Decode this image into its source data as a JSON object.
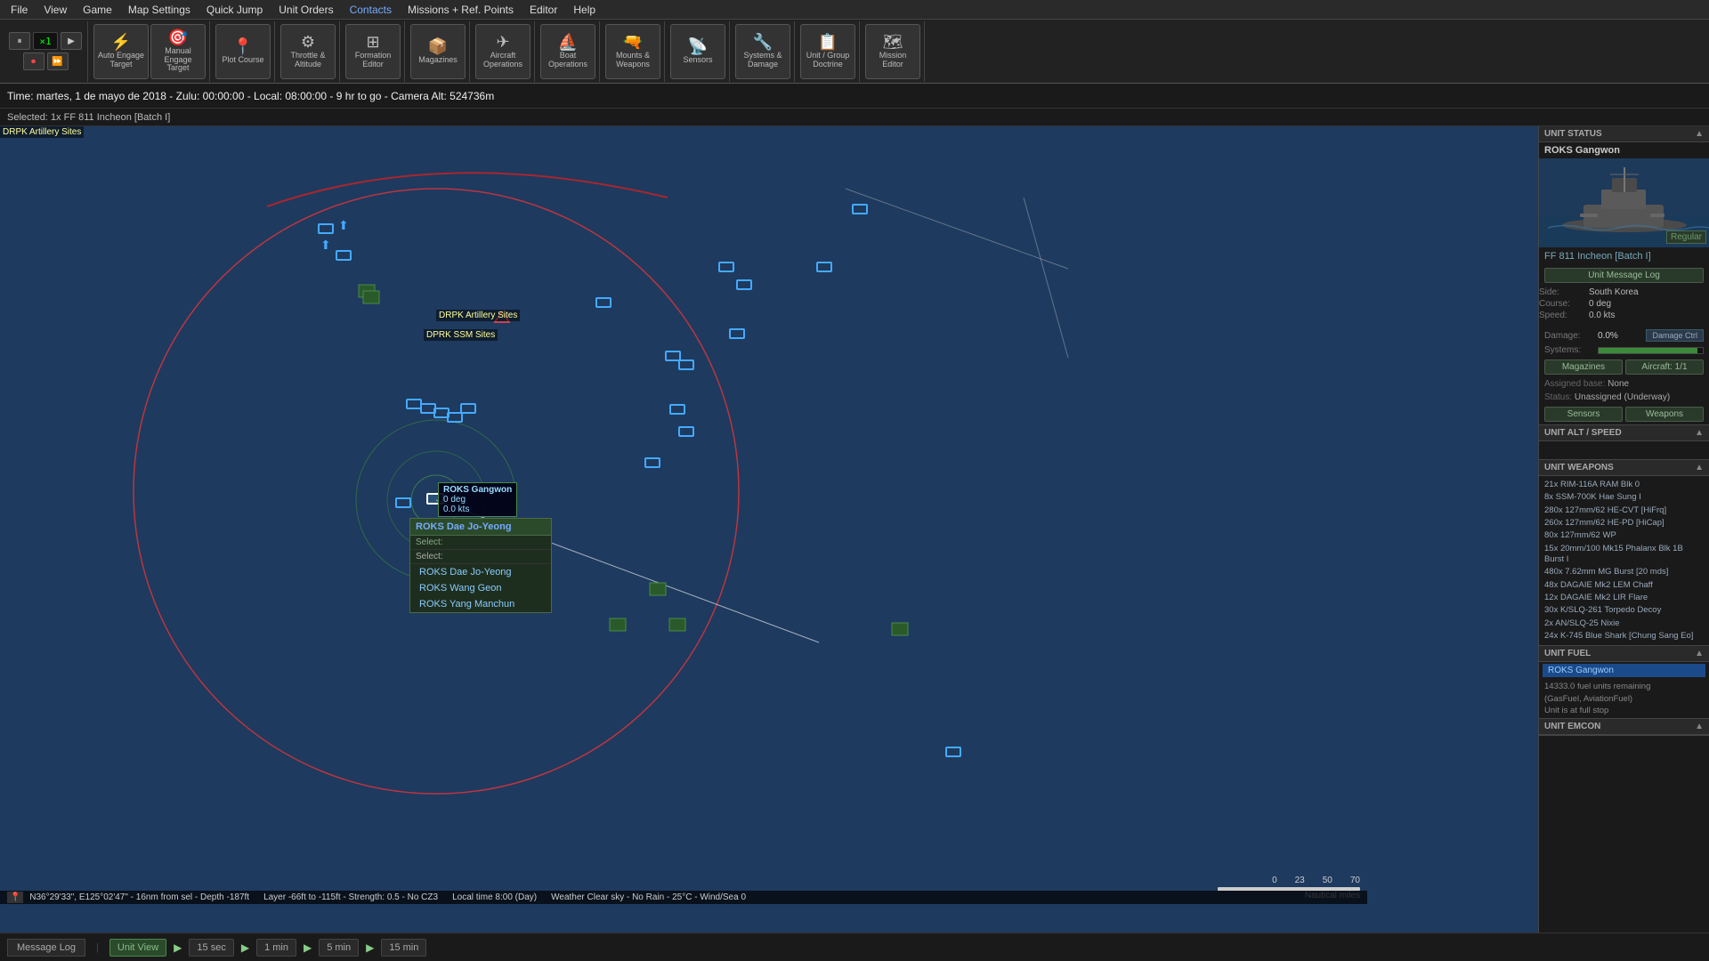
{
  "menu": {
    "items": [
      "File",
      "View",
      "Game",
      "Map Settings",
      "Quick Jump",
      "Unit Orders",
      "Contacts",
      "Missions + Ref. Points",
      "Editor",
      "Help"
    ]
  },
  "toolbar": {
    "groups": {
      "engage": {
        "auto_label": "Auto Engage Target",
        "manual_label": "Manual Engage Target"
      },
      "plot": {
        "label": "Plot Course"
      },
      "throttle": {
        "label": "Throttle & Altitude"
      },
      "formation": {
        "label": "Formation Editor"
      },
      "magazines": {
        "label": "Magazines"
      },
      "aircraft": {
        "label": "Aircraft Operations"
      },
      "boat": {
        "label": "Boat Operations"
      },
      "mounts": {
        "label": "Mounts & Weapons"
      },
      "sensors": {
        "label": "Sensors"
      },
      "systems": {
        "label": "Systems & Damage"
      },
      "doctrine": {
        "label": "Unit / Group Doctrine"
      },
      "mission": {
        "label": "Mission Editor"
      }
    },
    "speed": {
      "paused_icon": "⏸",
      "play_icon": "▶",
      "record_icon": "⏺",
      "multiplier": "×1",
      "fast_icon": "⏩"
    }
  },
  "status_bar": {
    "time_label": "Time: martes, 1 de mayo de 2018 - Zulu: 00:00:00 - Local: 08:00:00 - 9 hr to go -  Camera Alt: 524736m"
  },
  "selected_bar": {
    "label": "Selected:",
    "unit": "1x FF 811 Incheon [Batch I]"
  },
  "map": {
    "tooltip": {
      "name": "ROKS Gangwon",
      "course": "0 deg",
      "speed": "0.0 kts"
    },
    "context_menu": {
      "header": "ROKS Dae Jo-Yeong",
      "sub_label": "Select:",
      "items": [
        "ROKS Dae Jo-Yeong",
        "ROKS Wang Geon",
        "ROKS Yang Manchun"
      ]
    },
    "labels": [
      "DRPK Artillery Sites",
      "DPRK SSM Sites"
    ]
  },
  "right_panel": {
    "unit_status": {
      "section_title": "UNIT STATUS",
      "unit_name": "ROKS Gangwon",
      "ff_link": "FF 811 Incheon [Batch I]",
      "msg_log_btn": "Unit Message Log",
      "side_label": "Side:",
      "side_value": "South Korea",
      "course_label": "Course:",
      "course_value": "0 deg",
      "speed_label": "Speed:",
      "speed_value": "0.0 kts",
      "damage_label": "Damage:",
      "damage_value": "0.0%",
      "damage_ctrl": "Damage Ctrl",
      "systems_label": "Systems:",
      "systems_pct": 95,
      "magazines_btn": "Magazines",
      "aircraft_btn": "Aircraft: 1/1",
      "assigned_label": "Assigned base:",
      "assigned_value": "None",
      "status_label": "Status:",
      "status_value": "Unassigned (Underway)",
      "sensors_btn": "Sensors",
      "weapons_btn": "Weapons",
      "regular_label": "Regular"
    },
    "unit_alt_speed": {
      "section_title": "UNIT ALT / SPEED"
    },
    "unit_weapons": {
      "section_title": "UNIT WEAPONS",
      "items": [
        "21x RIM-116A RAM Blk 0",
        "8x SSM-700K Hae Sung I",
        "280x 127mm/62 HE-CVT [HiFrq]",
        "260x 127mm/62 HE-PD [HiCap]",
        "80x 127mm/62 WP",
        "15x 20mm/100 Mk15 Phalanx Blk 1B Burst I",
        "480x 7.62mm MG Burst [20 mds]",
        "48x DAGAIE Mk2 LEM Chaff",
        "12x DAGAIE Mk2 LIR Flare",
        "30x K/SLQ-261 Torpedo Decoy",
        "2x AN/SLQ-25 Nixie",
        "24x K-745 Blue Shark [Chung Sang Eo]"
      ]
    },
    "unit_fuel": {
      "section_title": "UNIT FUEL",
      "unit_name": "ROKS Gangwon",
      "fuel_remaining": "14333.0 fuel units remaining",
      "fuel_type": "(GasFuel, AviationFuel)",
      "status": "Unit is at full stop"
    },
    "unit_emcon": {
      "section_title": "UNIT EMCON"
    }
  },
  "bottom": {
    "msg_log": "Message Log",
    "view_btn": "Unit View",
    "time_steps": [
      "15 sec",
      "1 min",
      "5 min",
      "15 min"
    ],
    "coord": "N36°29'33\", E125°02'47\" - 16nm from sel - Depth -187ft",
    "layer": "Layer -66ft to -115ft - Strength: 0.5 - No CZ3",
    "local_time": "Local time 8:00 (Day)",
    "weather": "Weather Clear sky - No Rain - 25°C - Wind/Sea 0",
    "scale_marks": [
      "0",
      "23",
      "50",
      "70"
    ],
    "nautical_miles": "Nautical miles"
  }
}
